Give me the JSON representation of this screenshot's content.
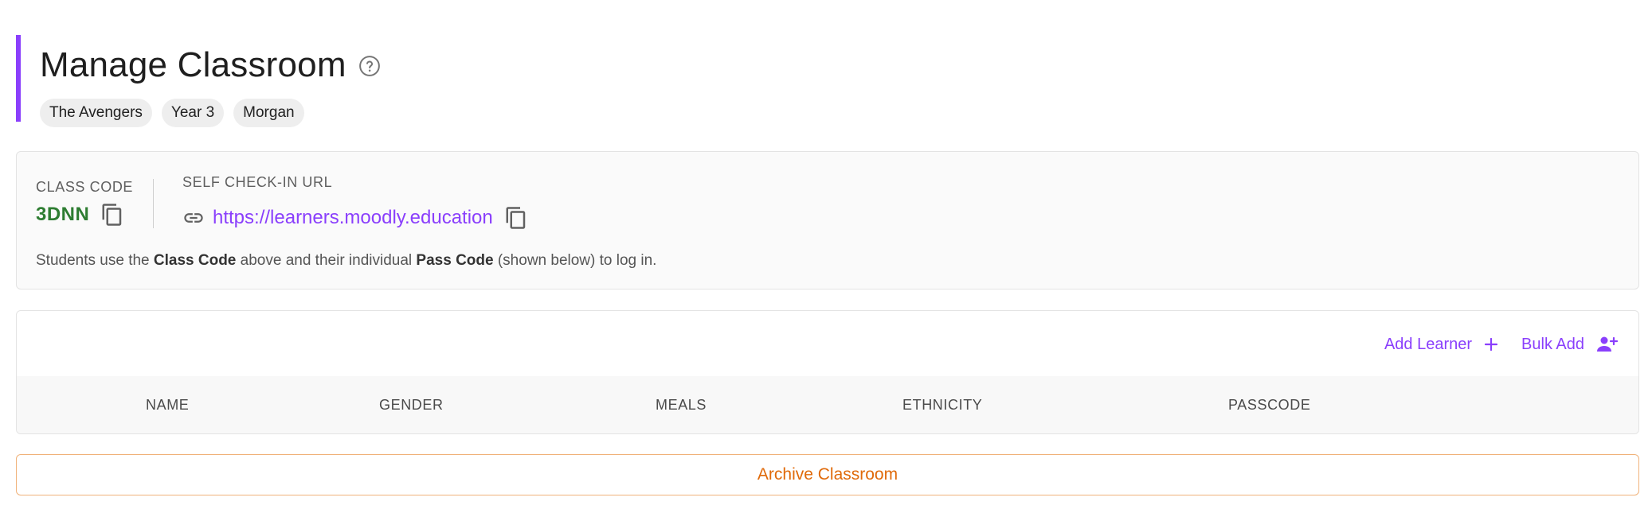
{
  "header": {
    "title": "Manage Classroom",
    "help_icon": "help-circle-icon",
    "chips": [
      "The Avengers",
      "Year 3",
      "Morgan"
    ]
  },
  "info": {
    "class_code_label": "CLASS CODE",
    "class_code": "3DNN",
    "url_label": "SELF CHECK-IN URL",
    "url": "https://learners.moodly.education",
    "help_prefix": "Students use the ",
    "help_bold_1": "Class Code",
    "help_middle": " above and their individual ",
    "help_bold_2": "Pass Code",
    "help_suffix": " (shown below) to log in."
  },
  "learners": {
    "add_learner_label": "Add Learner",
    "bulk_add_label": "Bulk Add",
    "columns": [
      "NAME",
      "GENDER",
      "MEALS",
      "ETHNICITY",
      "PASSCODE"
    ]
  },
  "archive_label": "Archive Classroom",
  "colors": {
    "accent": "#8a3ffc",
    "class_code": "#2e7d32",
    "archive": "#e06a0a"
  }
}
